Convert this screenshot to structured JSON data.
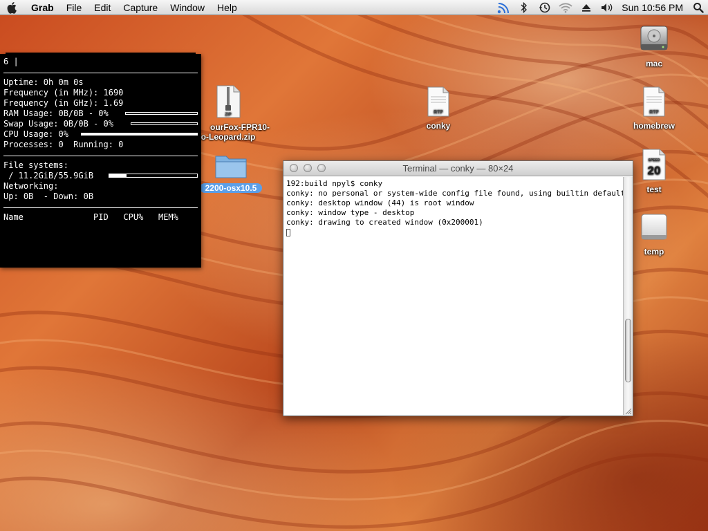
{
  "menubar": {
    "app_name": "Grab",
    "menus": [
      "File",
      "Edit",
      "Capture",
      "Window",
      "Help"
    ],
    "clock": "Sun 10:56 PM",
    "status_icons": [
      "network-activity-icon",
      "bluetooth-icon",
      "time-machine-icon",
      "wifi-icon",
      "eject-icon",
      "volume-icon",
      "spotlight-icon"
    ]
  },
  "conky": {
    "header": "6 |",
    "uptime": "Uptime: 0h 0m 0s",
    "freq_mhz": "Frequency (in MHz): 1690",
    "freq_ghz": "Frequency (in GHz): 1.69",
    "ram": "RAM Usage: 0B/0B - 0%",
    "swap": "Swap Usage: 0B/0B - 0%",
    "cpu": "CPU Usage: 0%",
    "processes": "Processes: 0  Running: 0",
    "filesystems_title": "File systems:",
    "fs_root": " / 11.2GiB/55.9GiB",
    "networking_title": "Networking:",
    "net": "Up: 0B  - Down: 0B",
    "table_header": "Name              PID   CPU%   MEM%",
    "ram_level": 0,
    "swap_level": 0,
    "cpu_level": 1.0,
    "fs_level": 0.2
  },
  "desktop_icons": {
    "mac": "mac",
    "zip_file_line1": "ourFox-FPR10-",
    "zip_file_line2": "o-Leopard.zip",
    "folder": "2200-osx10.5",
    "conky": "conky",
    "homebrew": "homebrew",
    "test": "test",
    "temp": "temp",
    "zip_badge": "ZIP",
    "rtf_badge": "RTF",
    "test_badge_top": "SPEED",
    "test_badge_num": "20"
  },
  "terminal": {
    "title": "Terminal — conky — 80×24",
    "lines": [
      "192:build npyl$ conky",
      "conky: no personal or system-wide config file found, using builtin default",
      "conky: desktop window (44) is root window",
      "conky: window type - desktop",
      "conky: drawing to created window (0x200001)"
    ]
  },
  "colors": {
    "menubar_bg": "#e6e6e6",
    "conky_bg": "#000000",
    "conky_fg": "#ffffff",
    "folder_selection": "#5b9fe8"
  }
}
